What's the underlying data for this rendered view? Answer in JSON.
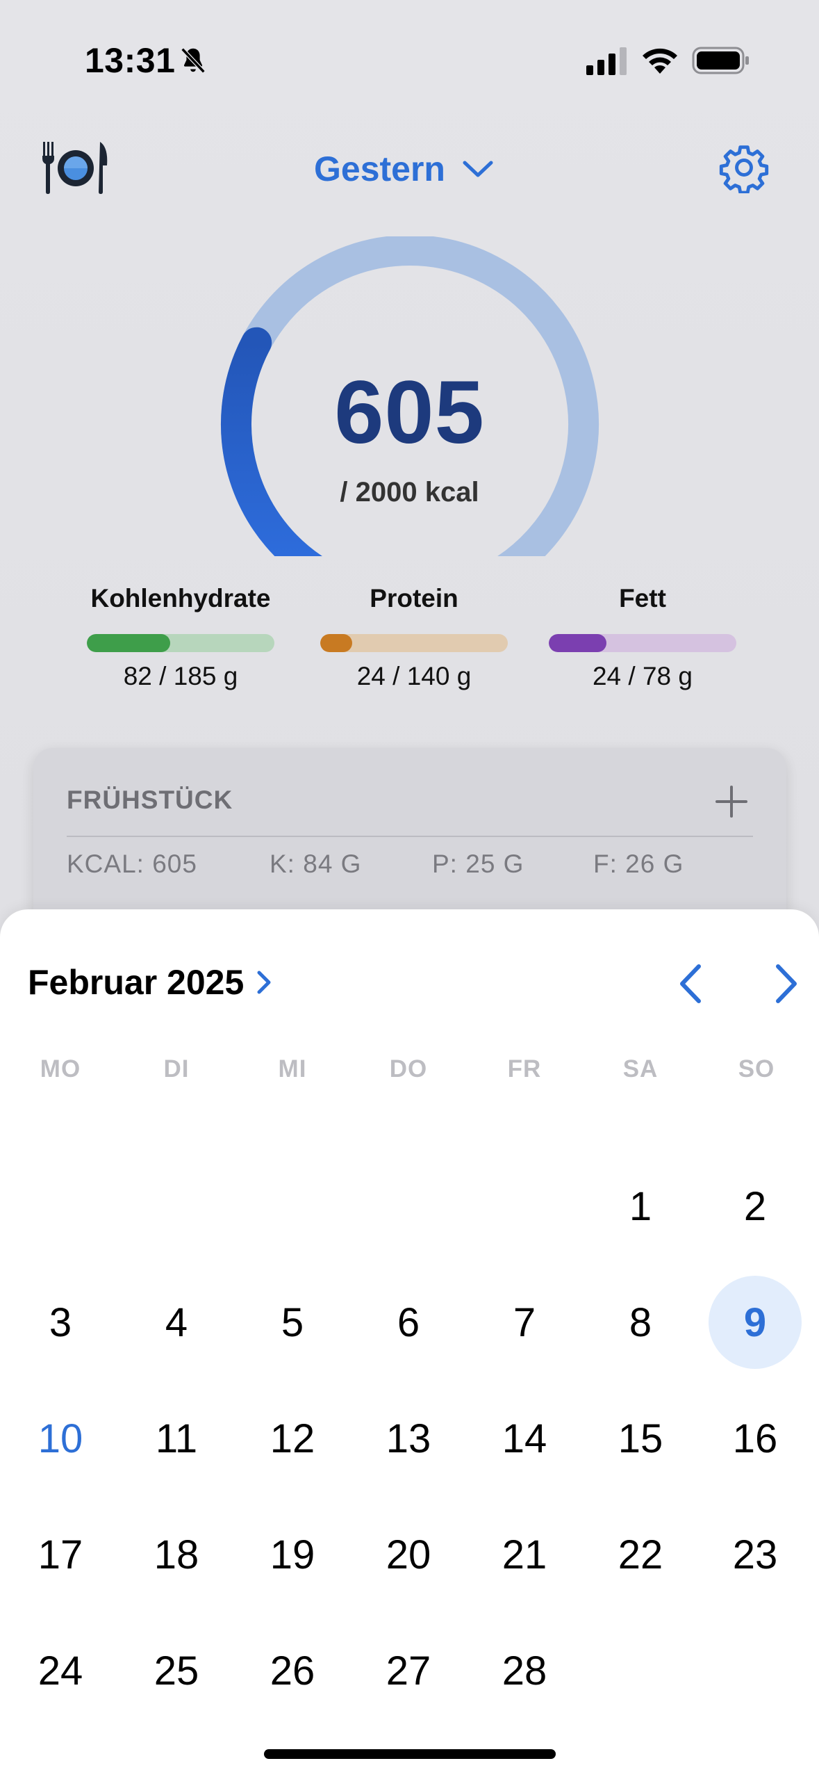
{
  "status_bar": {
    "time": "13:31",
    "icons": [
      "bell-slash-icon",
      "cellular-signal-icon",
      "wifi-icon",
      "battery-icon"
    ]
  },
  "header": {
    "logo_icon": "plate-cutlery-icon",
    "date_label": "Gestern",
    "dropdown_icon": "chevron-down-icon",
    "settings_icon": "gear-icon"
  },
  "summary": {
    "kcal_consumed": "605",
    "kcal_goal_label": "/ 2000 kcal",
    "progress_fraction": 0.3025
  },
  "macros": [
    {
      "label": "Kohlenhydrate",
      "value_label": "82 / 185 g",
      "fraction": 0.443,
      "color": "#3e9e4a",
      "track_color": "#b7d6bc"
    },
    {
      "label": "Protein",
      "value_label": "24 / 140 g",
      "fraction": 0.171,
      "color": "#c87a22",
      "track_color": "#e1cbb0"
    },
    {
      "label": "Fett",
      "value_label": "24 / 78 g",
      "fraction": 0.308,
      "color": "#7b3fb0",
      "track_color": "#d5c2e0"
    }
  ],
  "meal": {
    "title": "FRÜHSTÜCK",
    "add_icon": "plus-icon",
    "stats": [
      "KCAL: 605",
      "K: 84 G",
      "P: 25 G",
      "F: 26 G"
    ]
  },
  "calendar": {
    "month_label": "Februar 2025",
    "month_chevron_icon": "chevron-right-icon",
    "prev_icon": "chevron-left-icon",
    "next_icon": "chevron-right-icon",
    "weekdays": [
      "MO",
      "DI",
      "MI",
      "DO",
      "FR",
      "SA",
      "SO"
    ],
    "first_weekday_index": 5,
    "days_in_month": 28,
    "selected_day": 9,
    "today_day": 10,
    "accent": "#2d6fd6"
  }
}
